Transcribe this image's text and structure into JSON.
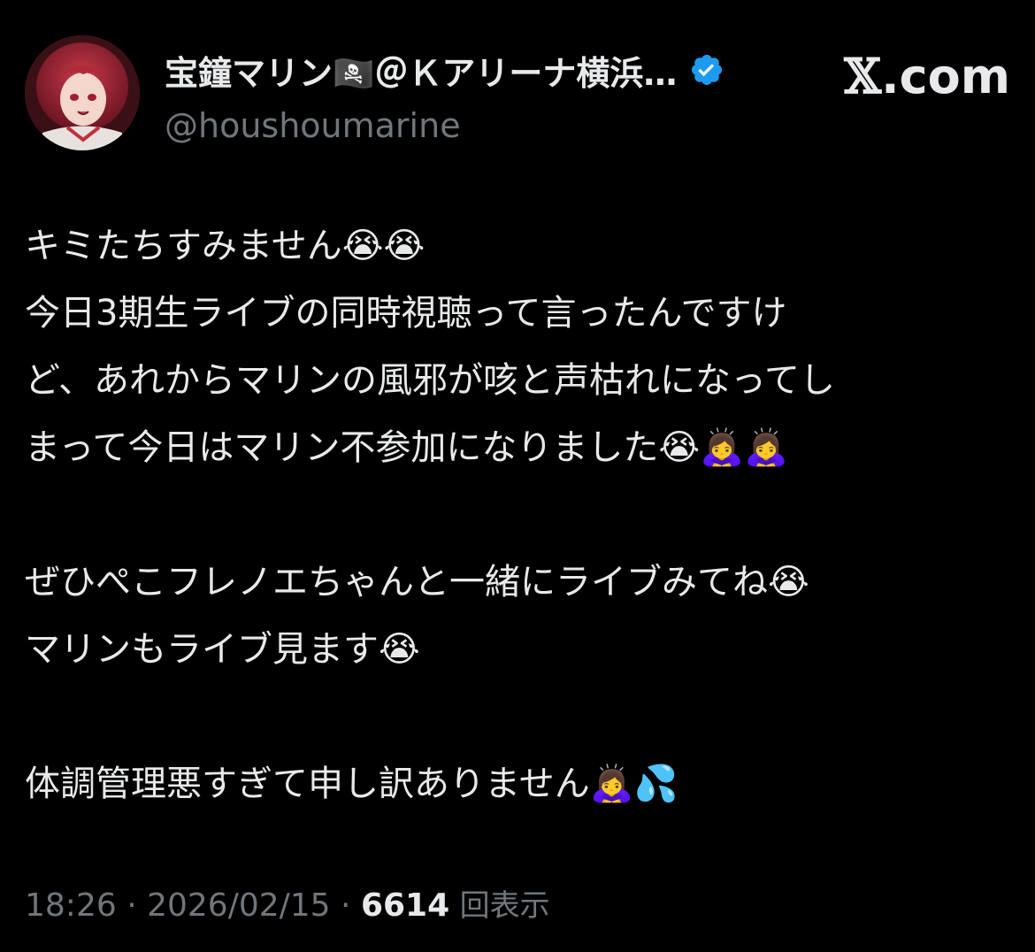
{
  "author": {
    "display_name": "宝鐘マリン🏴‍☠️＠Ｋアリーナ横浜…",
    "handle": "@houshoumarine",
    "verified_color": "#1d9bf0"
  },
  "site": {
    "logo_glyph": "𝕏",
    "logo_suffix": ".com"
  },
  "tweet": {
    "lines": [
      "キミたちすみません😭😭",
      "今日3期生ライブの同時視聴って言ったんですけ",
      "ど、あれからマリンの風邪が咳と声枯れになってし",
      "まって今日はマリン不参加になりました😭🙇‍♀️🙇‍♀️",
      "",
      "ぜひぺこフレノエちゃんと一緒にライブみてね😭",
      "マリンもライブ見ます😭",
      "",
      "体調管理悪すぎて申し訳ありません🙇‍♀️💦"
    ]
  },
  "meta": {
    "time": "18:26",
    "separator": " · ",
    "date": "2026/02/15",
    "views_count": "6614",
    "views_label": "回表示"
  },
  "colors": {
    "background": "#000000",
    "text_primary": "#e7e9ea",
    "text_secondary": "#71767b"
  }
}
